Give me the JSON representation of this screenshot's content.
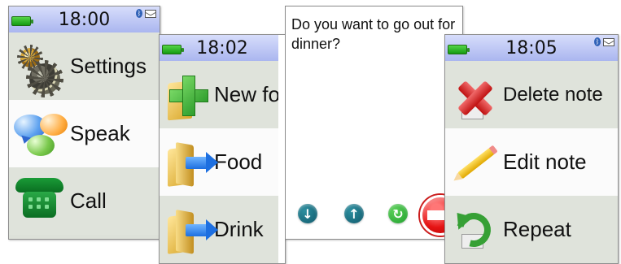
{
  "screens": [
    {
      "time": "18:00",
      "items": [
        {
          "label": "Settings",
          "icon": "gear-icon",
          "highlighted": false
        },
        {
          "label": "Speak",
          "icon": "speech-bubbles-icon",
          "highlighted": true
        },
        {
          "label": "Call",
          "icon": "phone-icon",
          "highlighted": false
        }
      ]
    },
    {
      "time": "18:02",
      "items": [
        {
          "label": "New fo",
          "icon": "plus-icon",
          "highlighted": false
        },
        {
          "label": "Food",
          "icon": "folder-arrow-icon",
          "highlighted": true
        },
        {
          "label": "Drink",
          "icon": "folder-arrow-icon",
          "highlighted": false
        }
      ]
    },
    {
      "question": "Do you want to go out for dinner?"
    },
    {
      "time": "18:05",
      "items": [
        {
          "label": "Delete note",
          "icon": "delete-x-icon",
          "highlighted": false
        },
        {
          "label": "Edit note",
          "icon": "pencil-icon",
          "highlighted": true
        },
        {
          "label": "Repeat",
          "icon": "repeat-icon",
          "highlighted": false
        }
      ]
    }
  ],
  "colors": {
    "status_bar": "#aab6ef",
    "menu_gray": "#dfe3db",
    "highlight": "#fbfbfb",
    "battery_green": "#2fb82b",
    "teal_button": "#11596b",
    "green_button": "#1d9e2c",
    "red_button": "#e51414"
  }
}
